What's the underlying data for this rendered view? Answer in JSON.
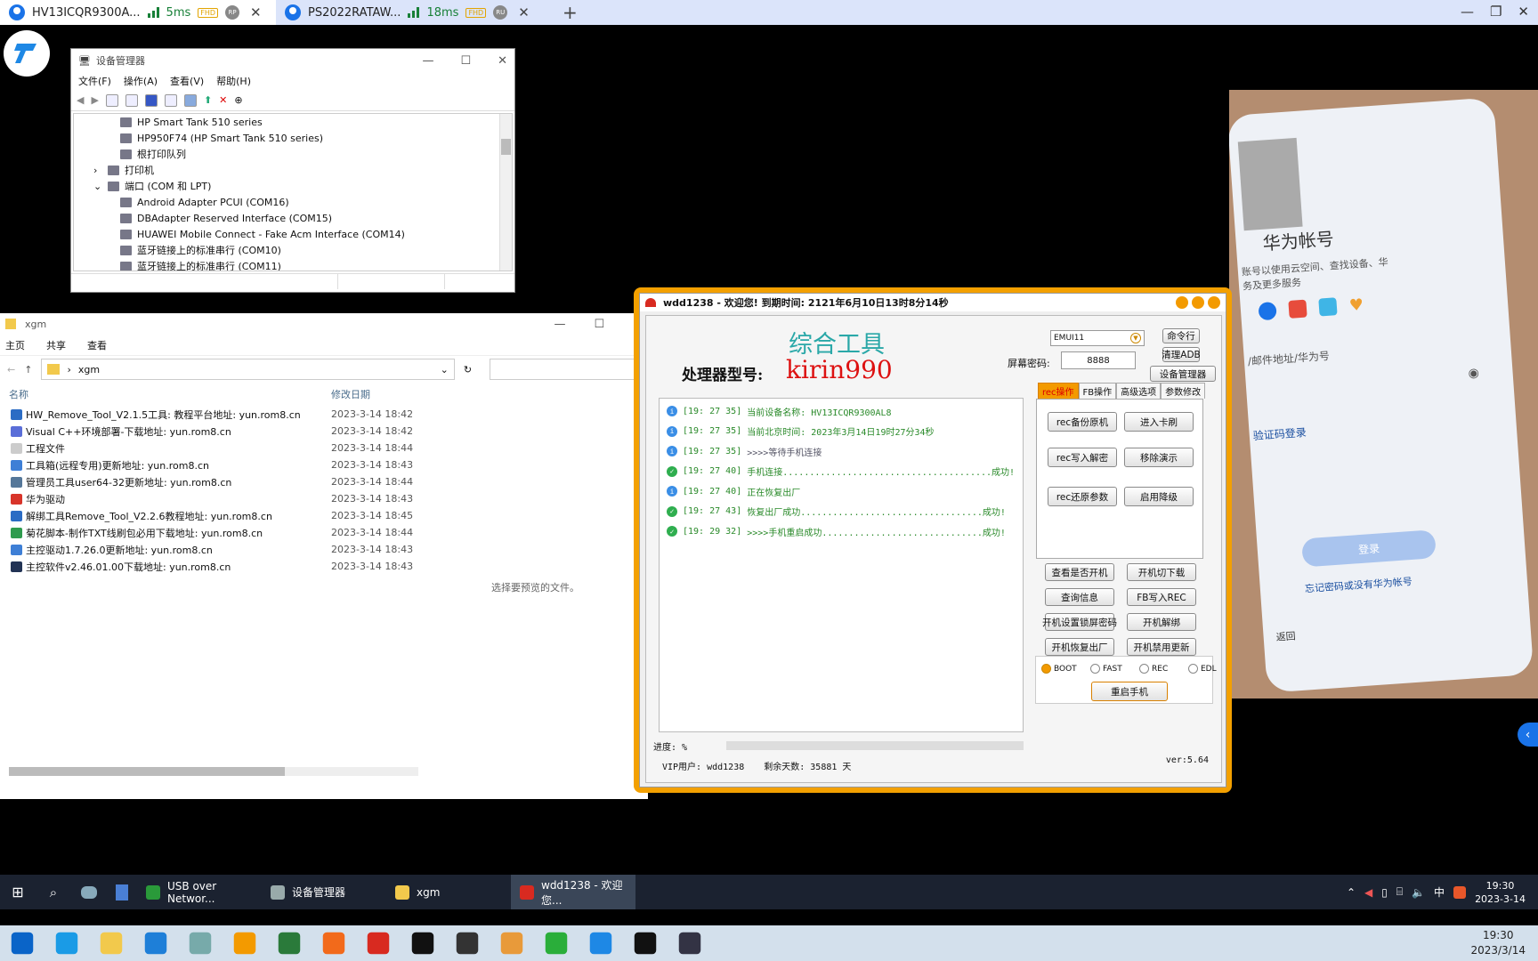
{
  "browser": {
    "tabs": [
      {
        "title": "HV13ICQR9300A...",
        "latency": "5ms",
        "quality": "FHD",
        "badge": "RP"
      },
      {
        "title": "PS2022RATAW...",
        "latency": "18ms",
        "quality": "FHD",
        "badge": "RU"
      }
    ],
    "new_tab": "+"
  },
  "device_manager": {
    "title": "设备管理器",
    "menu": [
      "文件(F)",
      "操作(A)",
      "查看(V)",
      "帮助(H)"
    ],
    "tree": [
      {
        "label": "HP Smart Tank 510 series",
        "indent": 3
      },
      {
        "label": "HP950F74 (HP Smart Tank 510 series)",
        "indent": 3
      },
      {
        "label": "根打印队列",
        "indent": 3
      },
      {
        "label": "打印机",
        "indent": 2,
        "toggle": ">"
      },
      {
        "label": "端口 (COM 和 LPT)",
        "indent": 2,
        "toggle": "v"
      },
      {
        "label": "Android Adapter PCUI (COM16)",
        "indent": 3
      },
      {
        "label": "DBAdapter Reserved Interface (COM15)",
        "indent": 3
      },
      {
        "label": "HUAWEI Mobile Connect - Fake Acm Interface (COM14)",
        "indent": 3
      },
      {
        "label": "蓝牙链接上的标准串行 (COM10)",
        "indent": 3
      },
      {
        "label": "蓝牙链接上的标准串行 (COM11)",
        "indent": 3
      }
    ]
  },
  "explorer": {
    "title": "xgm",
    "tabs": [
      "主页",
      "共享",
      "查看"
    ],
    "path": "xgm",
    "col_name": "名称",
    "col_date": "修改日期",
    "preview": "选择要预览的文件。",
    "files": [
      {
        "name": "HW_Remove_Tool_V2.1.5工具: 教程平台地址: yun.rom8.cn",
        "date": "2023-3-14 18:42",
        "color": "#2b6cc4"
      },
      {
        "name": "Visual C++环境部署-下载地址: yun.rom8.cn",
        "date": "2023-3-14 18:42",
        "color": "#5a6ed8"
      },
      {
        "name": "工程文件",
        "date": "2023-3-14 18:44",
        "color": "#cccccc"
      },
      {
        "name": "工具箱(远程专用)更新地址: yun.rom8.cn",
        "date": "2023-3-14 18:43",
        "color": "#3e7fd6"
      },
      {
        "name": "管理员工具user64-32更新地址: yun.rom8.cn",
        "date": "2023-3-14 18:44",
        "color": "#557799"
      },
      {
        "name": "华为驱动",
        "date": "2023-3-14 18:43",
        "color": "#d8342a"
      },
      {
        "name": "解绑工具Remove_Tool_V2.2.6教程地址: yun.rom8.cn",
        "date": "2023-3-14 18:45",
        "color": "#2b6cc4"
      },
      {
        "name": "菊花脚本-制作TXT线刷包必用下载地址: yun.rom8.cn",
        "date": "2023-3-14 18:44",
        "color": "#2f9b4e"
      },
      {
        "name": "主控驱动1.7.26.0更新地址: yun.rom8.cn",
        "date": "2023-3-14 18:43",
        "color": "#3e7fd6"
      },
      {
        "name": "主控软件v2.46.01.00下载地址: yun.rom8.cn",
        "date": "2023-3-14 18:43",
        "color": "#223355"
      }
    ]
  },
  "phone": {
    "title": "华为帐号",
    "line1": "账号以使用云空间、查找设备、华",
    "line2": "务及更多服务",
    "field": "/邮件地址/华为号",
    "sms": "验证码登录",
    "login": "登录",
    "forgot": "忘记密码或没有华为帐号",
    "back": "返回"
  },
  "tool": {
    "title": "wdd1238 - 欢迎您!  到期时间: 2121年6月10日13时8分14秒",
    "heading": "综合工具",
    "cpu_label": "处理器型号:",
    "cpu_value": "kirin990",
    "version_select": "EMUI11",
    "cmd_btn": "命令行",
    "clear_adb": "清理ADB",
    "pwd_label": "屏幕密码:",
    "pwd_value": "8888",
    "devmgr_btn": "设备管理器",
    "tabs": [
      "rec操作",
      "FB操作",
      "高级选项",
      "参数修改"
    ],
    "panel_buttons": [
      "rec备份原机",
      "进入卡刷",
      "rec写入解密",
      "移除演示",
      "rec还原参数",
      "启用降级"
    ],
    "buttons": [
      "查看是否开机",
      "开机切下载",
      "查询信息",
      "FB写入REC",
      "开机设置锁屏密码",
      "开机解绑",
      "开机恢复出厂",
      "开机禁用更新"
    ],
    "modes": [
      "BOOT",
      "FAST",
      "REC",
      "EDL"
    ],
    "reboot": "重启手机",
    "log": [
      {
        "type": "info",
        "time": "[19: 27 35]",
        "text": "当前设备名称: HV13ICQR9300AL8"
      },
      {
        "type": "info",
        "time": "[19: 27 35]",
        "text": "当前北京时间: 2023年3月14日19时27分34秒"
      },
      {
        "type": "info",
        "time": "[19: 27 35]",
        "text": ">>>>等待手机连接"
      },
      {
        "type": "ok",
        "time": "[19: 27 40]",
        "text": "手机连接.......................................成功!"
      },
      {
        "type": "info",
        "time": "[19: 27 40]",
        "text": "正在恢复出厂"
      },
      {
        "type": "ok",
        "time": "[19: 27 43]",
        "text": "恢复出厂成功..................................成功!"
      },
      {
        "type": "ok",
        "time": "[19: 29 32]",
        "text": ">>>>手机重启成功..............................成功!"
      }
    ],
    "progress": "进度: %",
    "vip": "VIP用户: wdd1238",
    "days": "剩余天数: 35881 天",
    "ver": "ver:5.64"
  },
  "taskbar_remote": {
    "tasks": [
      "USB over Networ...",
      "设备管理器",
      "xgm",
      "wdd1238 - 欢迎您..."
    ],
    "ime": "中",
    "time": "19:30",
    "date": "2023-3-14"
  },
  "taskbar_local": {
    "time": "19:30",
    "date": "2023/3/14"
  }
}
